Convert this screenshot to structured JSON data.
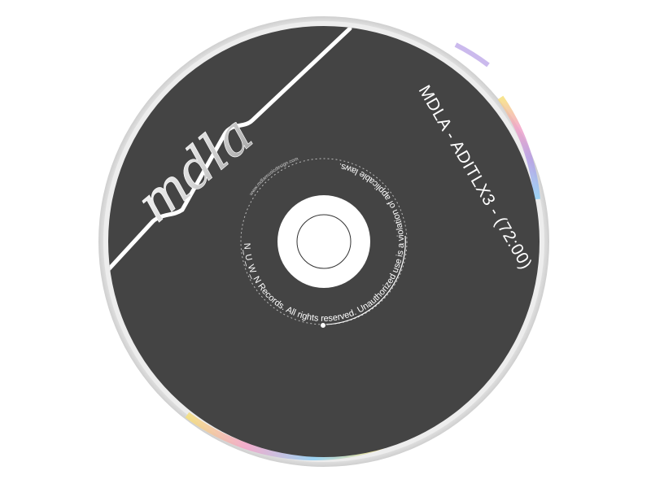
{
  "disc": {
    "logo_text": "mdla",
    "title": "MDLA - ADITLX3 - (72:00)",
    "curved_text_main": "F_I_C_N_S_N_U_W_N Records.  All rights reserved.  Unauthorized use is a violation of applicable laws.",
    "curved_text_url": "www.mdlamusicdesign.com"
  },
  "colors": {
    "background": "#ffffff",
    "disc_label": "#444444",
    "disc_rim": "#e6e6e6",
    "disc_rim_inner": "#cfcfcf",
    "hub": "#ffffff",
    "ink": "#ffffff",
    "hub_ring": "#333333",
    "rainbow_1": "#f6e07a",
    "rainbow_2": "#f3a2c7",
    "rainbow_3": "#b59ce6",
    "rainbow_4": "#8ecff5"
  }
}
